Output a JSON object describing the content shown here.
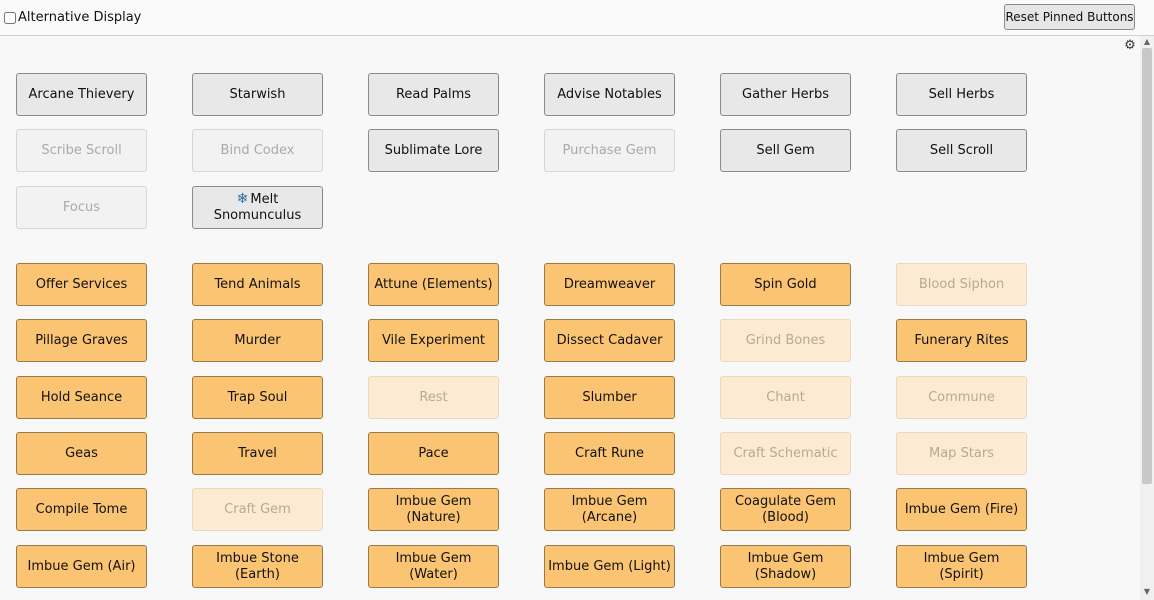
{
  "header": {
    "alt_display_label": "Alternative Display",
    "reset_label": "Reset Pinned Buttons"
  },
  "icons": {
    "settings": "gear-icon",
    "snowflake": "snowflake-icon"
  },
  "colors": {
    "orange": "#fbc473",
    "grey": "#e8e8e8"
  },
  "grey_buttons": [
    {
      "label": "Arcane Thievery",
      "enabled": true
    },
    {
      "label": "Starwish",
      "enabled": true
    },
    {
      "label": "Read Palms",
      "enabled": true
    },
    {
      "label": "Advise Notables",
      "enabled": true
    },
    {
      "label": "Gather Herbs",
      "enabled": true
    },
    {
      "label": "Sell Herbs",
      "enabled": true
    },
    {
      "label": "Scribe Scroll",
      "enabled": false
    },
    {
      "label": "Bind Codex",
      "enabled": false
    },
    {
      "label": "Sublimate Lore",
      "enabled": true
    },
    {
      "label": "Purchase Gem",
      "enabled": false
    },
    {
      "label": "Sell Gem",
      "enabled": true
    },
    {
      "label": "Sell Scroll",
      "enabled": true
    },
    {
      "label": "Focus",
      "enabled": false
    },
    {
      "label": "Melt Snomunculus",
      "enabled": true,
      "icon": "snowflake-icon"
    }
  ],
  "orange_buttons": [
    {
      "label": "Offer Services",
      "enabled": true
    },
    {
      "label": "Tend Animals",
      "enabled": true
    },
    {
      "label": "Attune (Elements)",
      "enabled": true
    },
    {
      "label": "Dreamweaver",
      "enabled": true
    },
    {
      "label": "Spin Gold",
      "enabled": true
    },
    {
      "label": "Blood Siphon",
      "enabled": false
    },
    {
      "label": "Pillage Graves",
      "enabled": true
    },
    {
      "label": "Murder",
      "enabled": true
    },
    {
      "label": "Vile Experiment",
      "enabled": true
    },
    {
      "label": "Dissect Cadaver",
      "enabled": true
    },
    {
      "label": "Grind Bones",
      "enabled": false
    },
    {
      "label": "Funerary Rites",
      "enabled": true
    },
    {
      "label": "Hold Seance",
      "enabled": true
    },
    {
      "label": "Trap Soul",
      "enabled": true
    },
    {
      "label": "Rest",
      "enabled": false
    },
    {
      "label": "Slumber",
      "enabled": true
    },
    {
      "label": "Chant",
      "enabled": false
    },
    {
      "label": "Commune",
      "enabled": false
    },
    {
      "label": "Geas",
      "enabled": true
    },
    {
      "label": "Travel",
      "enabled": true
    },
    {
      "label": "Pace",
      "enabled": true
    },
    {
      "label": "Craft Rune",
      "enabled": true
    },
    {
      "label": "Craft Schematic",
      "enabled": false
    },
    {
      "label": "Map Stars",
      "enabled": false
    },
    {
      "label": "Compile Tome",
      "enabled": true
    },
    {
      "label": "Craft Gem",
      "enabled": false
    },
    {
      "label": "Imbue Gem (Nature)",
      "enabled": true
    },
    {
      "label": "Imbue Gem (Arcane)",
      "enabled": true
    },
    {
      "label": "Coagulate Gem (Blood)",
      "enabled": true
    },
    {
      "label": "Imbue Gem (Fire)",
      "enabled": true
    },
    {
      "label": "Imbue Gem (Air)",
      "enabled": true
    },
    {
      "label": "Imbue Stone (Earth)",
      "enabled": true
    },
    {
      "label": "Imbue Gem (Water)",
      "enabled": true
    },
    {
      "label": "Imbue Gem (Light)",
      "enabled": true
    },
    {
      "label": "Imbue Gem (Shadow)",
      "enabled": true
    },
    {
      "label": "Imbue Gem (Spirit)",
      "enabled": true
    }
  ]
}
